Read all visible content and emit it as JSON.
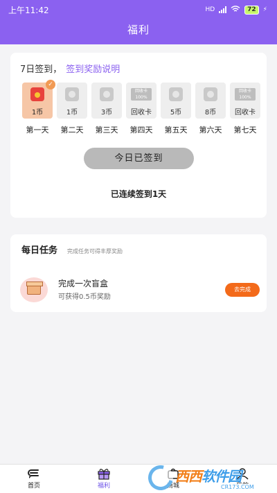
{
  "status_bar": {
    "time": "上午11:42",
    "network": "HD",
    "battery": "72"
  },
  "header": {
    "title": "福利"
  },
  "signin": {
    "days_label": "7日签到，",
    "rules_link": "签到奖励说明",
    "days": [
      {
        "name": "第一天",
        "value": "1币",
        "signed": true,
        "type": "coin"
      },
      {
        "name": "第二天",
        "value": "1币",
        "signed": false,
        "type": "coin"
      },
      {
        "name": "第三天",
        "value": "3币",
        "signed": false,
        "type": "coin"
      },
      {
        "name": "第四天",
        "value": "回收卡",
        "signed": false,
        "type": "card"
      },
      {
        "name": "第五天",
        "value": "5币",
        "signed": false,
        "type": "coin"
      },
      {
        "name": "第六天",
        "value": "8币",
        "signed": false,
        "type": "coin"
      },
      {
        "name": "第七天",
        "value": "回收卡",
        "signed": false,
        "type": "card"
      }
    ],
    "card_icon_text": "回收卡",
    "card_icon_percent": "100%",
    "signed_button": "今日已签到",
    "streak_text": "已连续签到1天"
  },
  "tasks": {
    "title": "每日任务",
    "subtitle": "完成任务可得丰厚奖励",
    "items": [
      {
        "title": "完成一次盲盒",
        "desc": "可获得0.5币奖励",
        "button": "去完成"
      }
    ]
  },
  "tabbar": {
    "items": [
      {
        "label": "首页",
        "icon": "home-icon",
        "active": false
      },
      {
        "label": "福利",
        "icon": "gift-icon",
        "active": true
      },
      {
        "label": "商城",
        "icon": "shop-icon",
        "active": false
      },
      {
        "label": "我的",
        "icon": "profile-icon",
        "active": false
      }
    ]
  },
  "colors": {
    "accent": "#8b61f0",
    "button_orange": "#f36a1a",
    "active_tab": "#6d53e8"
  }
}
